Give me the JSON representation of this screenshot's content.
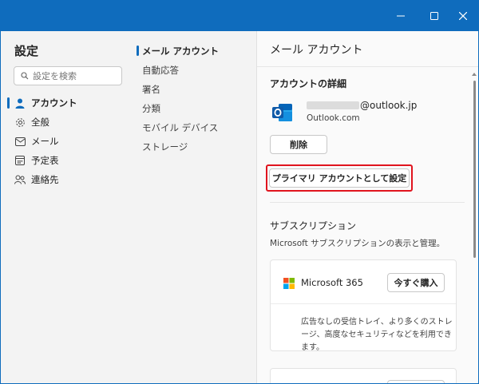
{
  "settings": {
    "title": "設定",
    "search_placeholder": "設定を検索",
    "nav": [
      {
        "label": "アカウント",
        "icon": "person-icon",
        "active": true
      },
      {
        "label": "全般",
        "icon": "gear-icon",
        "active": false
      },
      {
        "label": "メール",
        "icon": "mail-icon",
        "active": false
      },
      {
        "label": "予定表",
        "icon": "calendar-icon",
        "active": false
      },
      {
        "label": "連絡先",
        "icon": "people-icon",
        "active": false
      }
    ]
  },
  "account_menu": {
    "items": [
      {
        "label": "メール アカウント",
        "active": true
      },
      {
        "label": "自動応答",
        "active": false
      },
      {
        "label": "署名",
        "active": false
      },
      {
        "label": "分類",
        "active": false
      },
      {
        "label": "モバイル デバイス",
        "active": false
      },
      {
        "label": "ストレージ",
        "active": false
      }
    ]
  },
  "content": {
    "title": "メール アカウント",
    "account_details_heading": "アカウントの詳細",
    "account": {
      "email_suffix": "@outlook.jp",
      "type": "Outlook.com"
    },
    "delete_label": "削除",
    "set_primary_label": "プライマリ アカウントとして設定",
    "subscription_heading": "サブスクリプション",
    "subscription_description": "Microsoft サブスクリプションの表示と管理。",
    "product": {
      "name": "Microsoft 365",
      "buy_label": "今すぐ購入",
      "description": "広告なしの受信トレイ、より多くのストレージ、高度なセキュリティなどを利用できます。"
    }
  },
  "colors": {
    "titlebar": "#0f6cbd",
    "accent": "#0f6cbd",
    "highlight": "#e0141e"
  }
}
